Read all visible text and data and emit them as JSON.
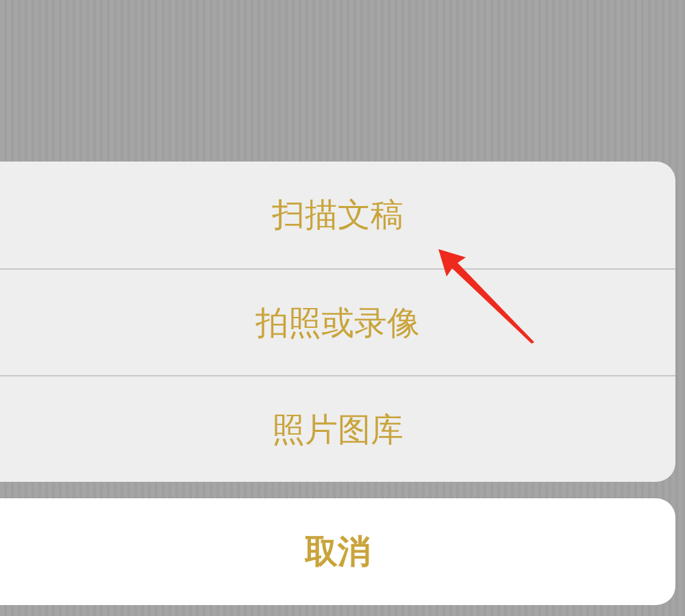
{
  "action_sheet": {
    "options": [
      {
        "label": "扫描文稿"
      },
      {
        "label": "拍照或录像"
      },
      {
        "label": "照片图库"
      }
    ],
    "cancel": {
      "label": "取消"
    }
  }
}
